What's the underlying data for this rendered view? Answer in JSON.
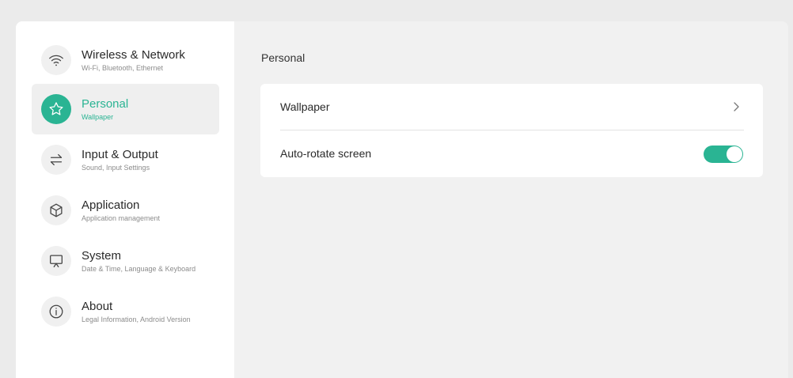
{
  "colors": {
    "accent": "#2ab493",
    "background": "#ebebeb",
    "sidebar_bg": "#ffffff",
    "main_bg": "#f1f1f1"
  },
  "sidebar": {
    "items": [
      {
        "title": "Wireless & Network",
        "subtitle": "Wi-Fi, Bluetooth, Ethernet",
        "icon": "wifi-icon",
        "active": false
      },
      {
        "title": "Personal",
        "subtitle": "Wallpaper",
        "icon": "star-icon",
        "active": true
      },
      {
        "title": "Input & Output",
        "subtitle": "Sound, Input Settings",
        "icon": "swap-arrows-icon",
        "active": false
      },
      {
        "title": "Application",
        "subtitle": "Application management",
        "icon": "cube-icon",
        "active": false
      },
      {
        "title": "System",
        "subtitle": "Date & Time, Language & Keyboard",
        "icon": "presentation-board-icon",
        "active": false
      },
      {
        "title": "About",
        "subtitle": "Legal Information, Android Version",
        "icon": "info-icon",
        "active": false
      }
    ]
  },
  "main": {
    "section_title": "Personal",
    "settings": [
      {
        "label": "Wallpaper",
        "control": "chevron-right-icon"
      },
      {
        "label": "Auto-rotate screen",
        "control": "toggle",
        "value": true
      }
    ]
  }
}
